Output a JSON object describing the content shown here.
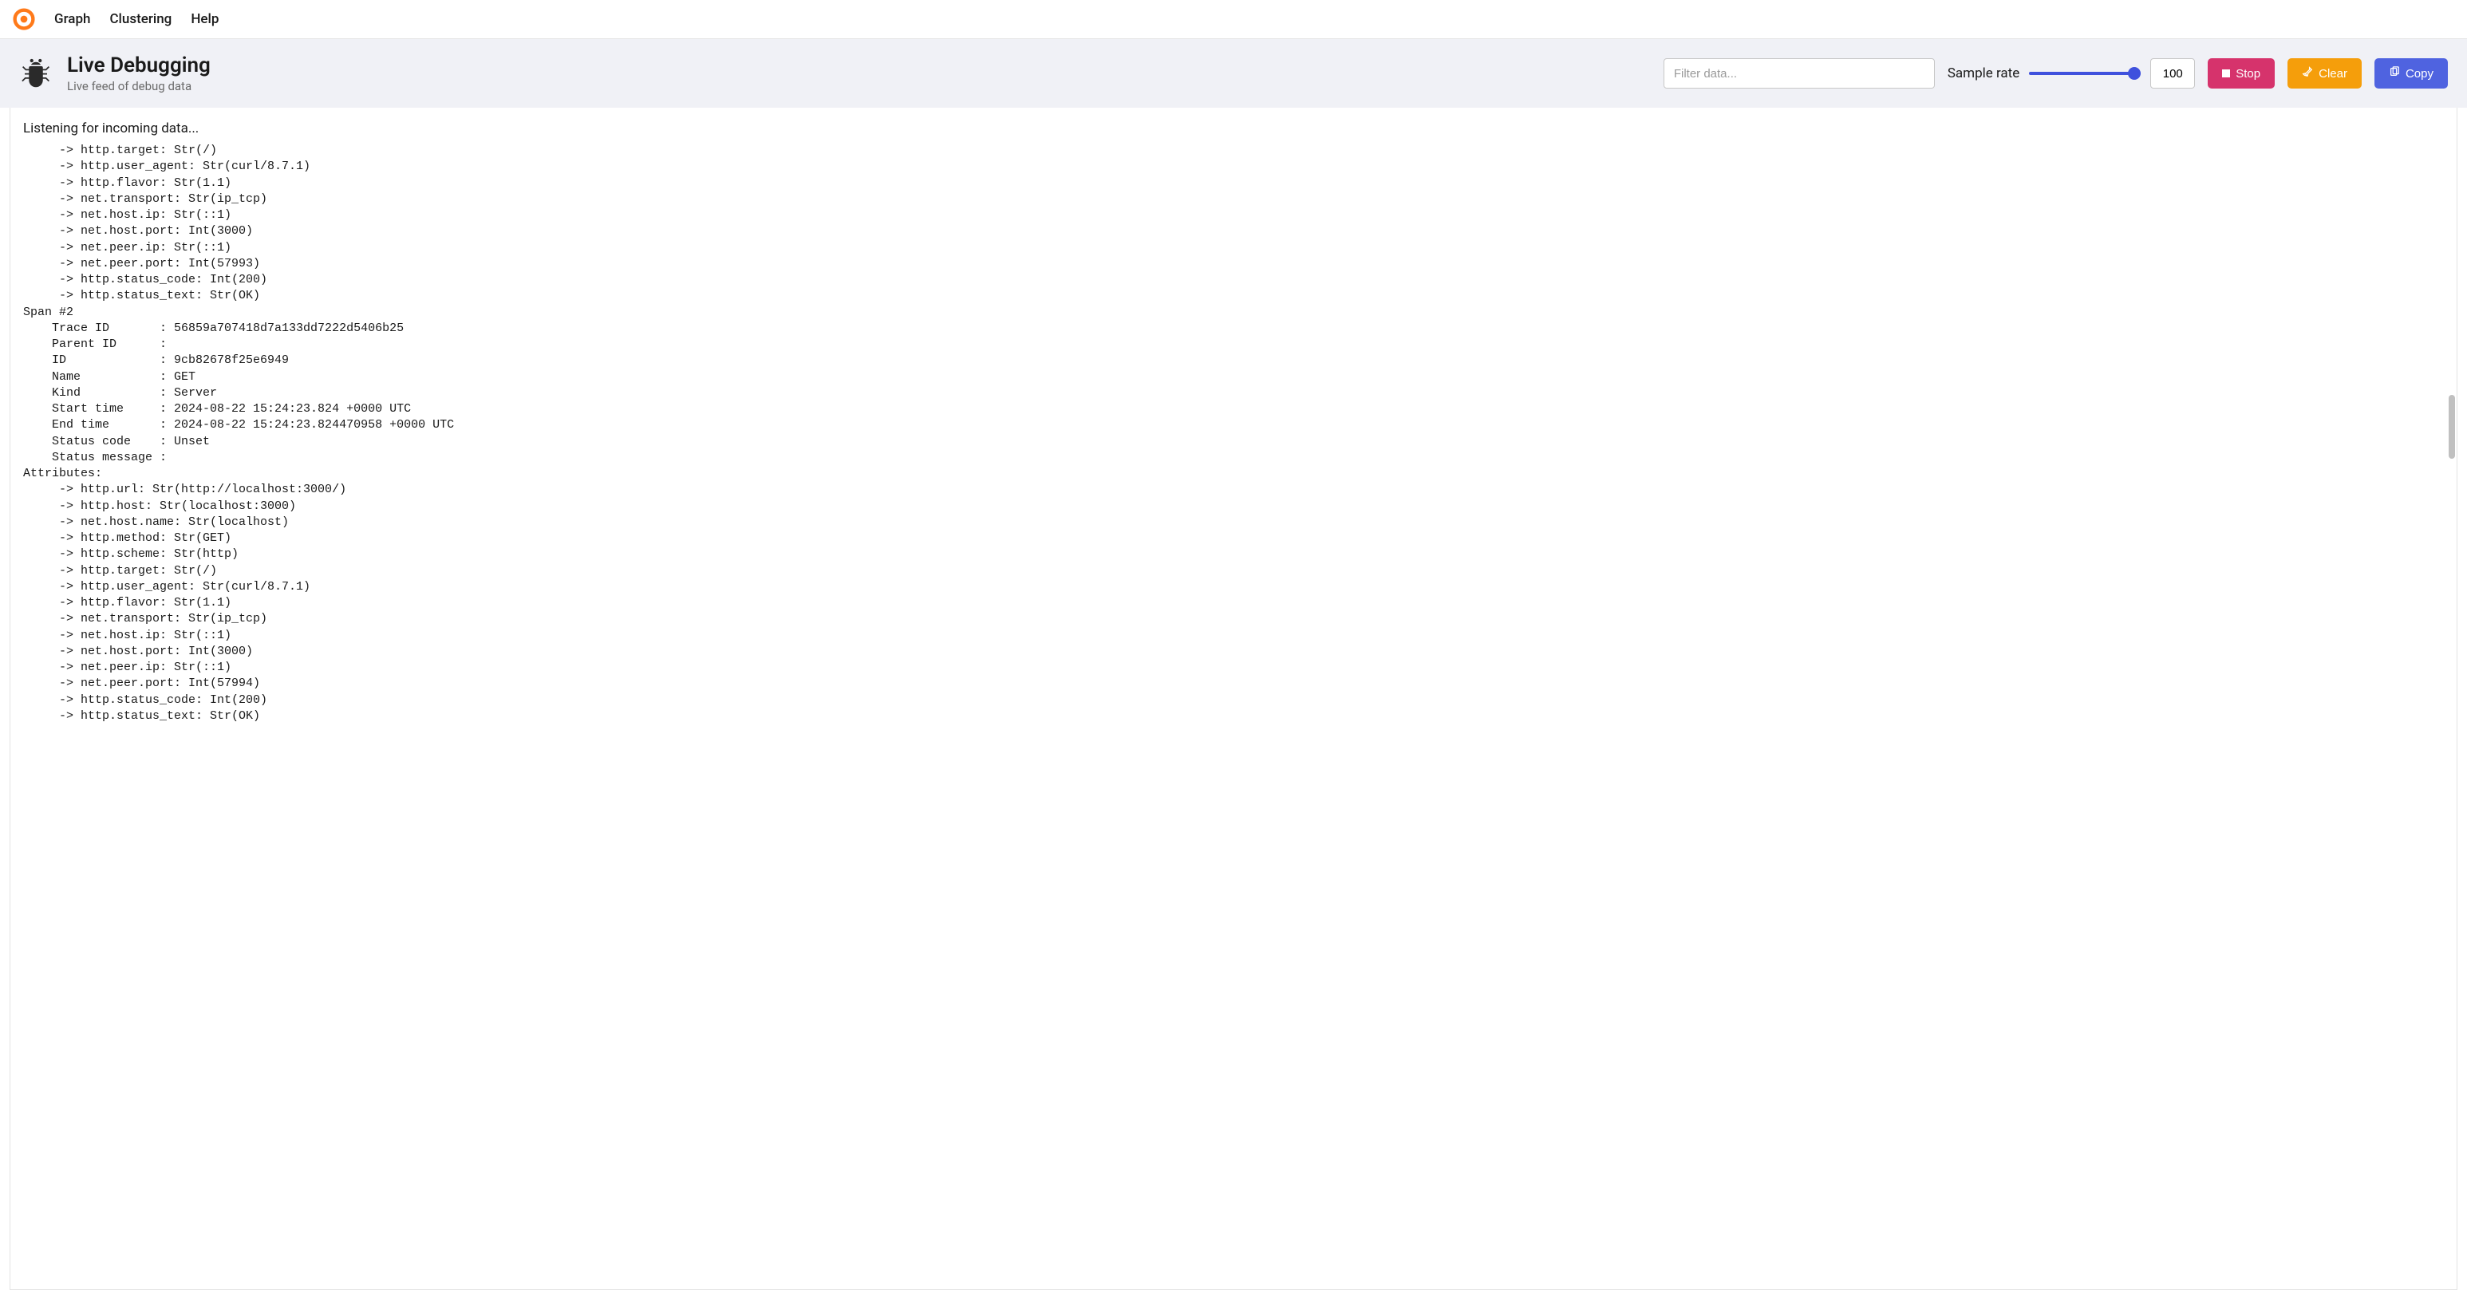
{
  "nav": {
    "graph": "Graph",
    "clustering": "Clustering",
    "help": "Help"
  },
  "header": {
    "title": "Live Debugging",
    "subtitle": "Live feed of debug data"
  },
  "controls": {
    "filter_placeholder": "Filter data...",
    "sample_rate_label": "Sample rate",
    "sample_rate_value": "100",
    "stop_label": "Stop",
    "clear_label": "Clear",
    "copy_label": "Copy"
  },
  "content": {
    "listening": "Listening for incoming data...",
    "debug_text": "     -> http.target: Str(/)\n     -> http.user_agent: Str(curl/8.7.1)\n     -> http.flavor: Str(1.1)\n     -> net.transport: Str(ip_tcp)\n     -> net.host.ip: Str(::1)\n     -> net.host.port: Int(3000)\n     -> net.peer.ip: Str(::1)\n     -> net.peer.port: Int(57993)\n     -> http.status_code: Int(200)\n     -> http.status_text: Str(OK)\nSpan #2\n    Trace ID       : 56859a707418d7a133dd7222d5406b25\n    Parent ID      : \n    ID             : 9cb82678f25e6949\n    Name           : GET\n    Kind           : Server\n    Start time     : 2024-08-22 15:24:23.824 +0000 UTC\n    End time       : 2024-08-22 15:24:23.824470958 +0000 UTC\n    Status code    : Unset\n    Status message : \nAttributes:\n     -> http.url: Str(http://localhost:3000/)\n     -> http.host: Str(localhost:3000)\n     -> net.host.name: Str(localhost)\n     -> http.method: Str(GET)\n     -> http.scheme: Str(http)\n     -> http.target: Str(/)\n     -> http.user_agent: Str(curl/8.7.1)\n     -> http.flavor: Str(1.1)\n     -> net.transport: Str(ip_tcp)\n     -> net.host.ip: Str(::1)\n     -> net.host.port: Int(3000)\n     -> net.peer.ip: Str(::1)\n     -> net.peer.port: Int(57994)\n     -> http.status_code: Int(200)\n     -> http.status_text: Str(OK)"
  }
}
